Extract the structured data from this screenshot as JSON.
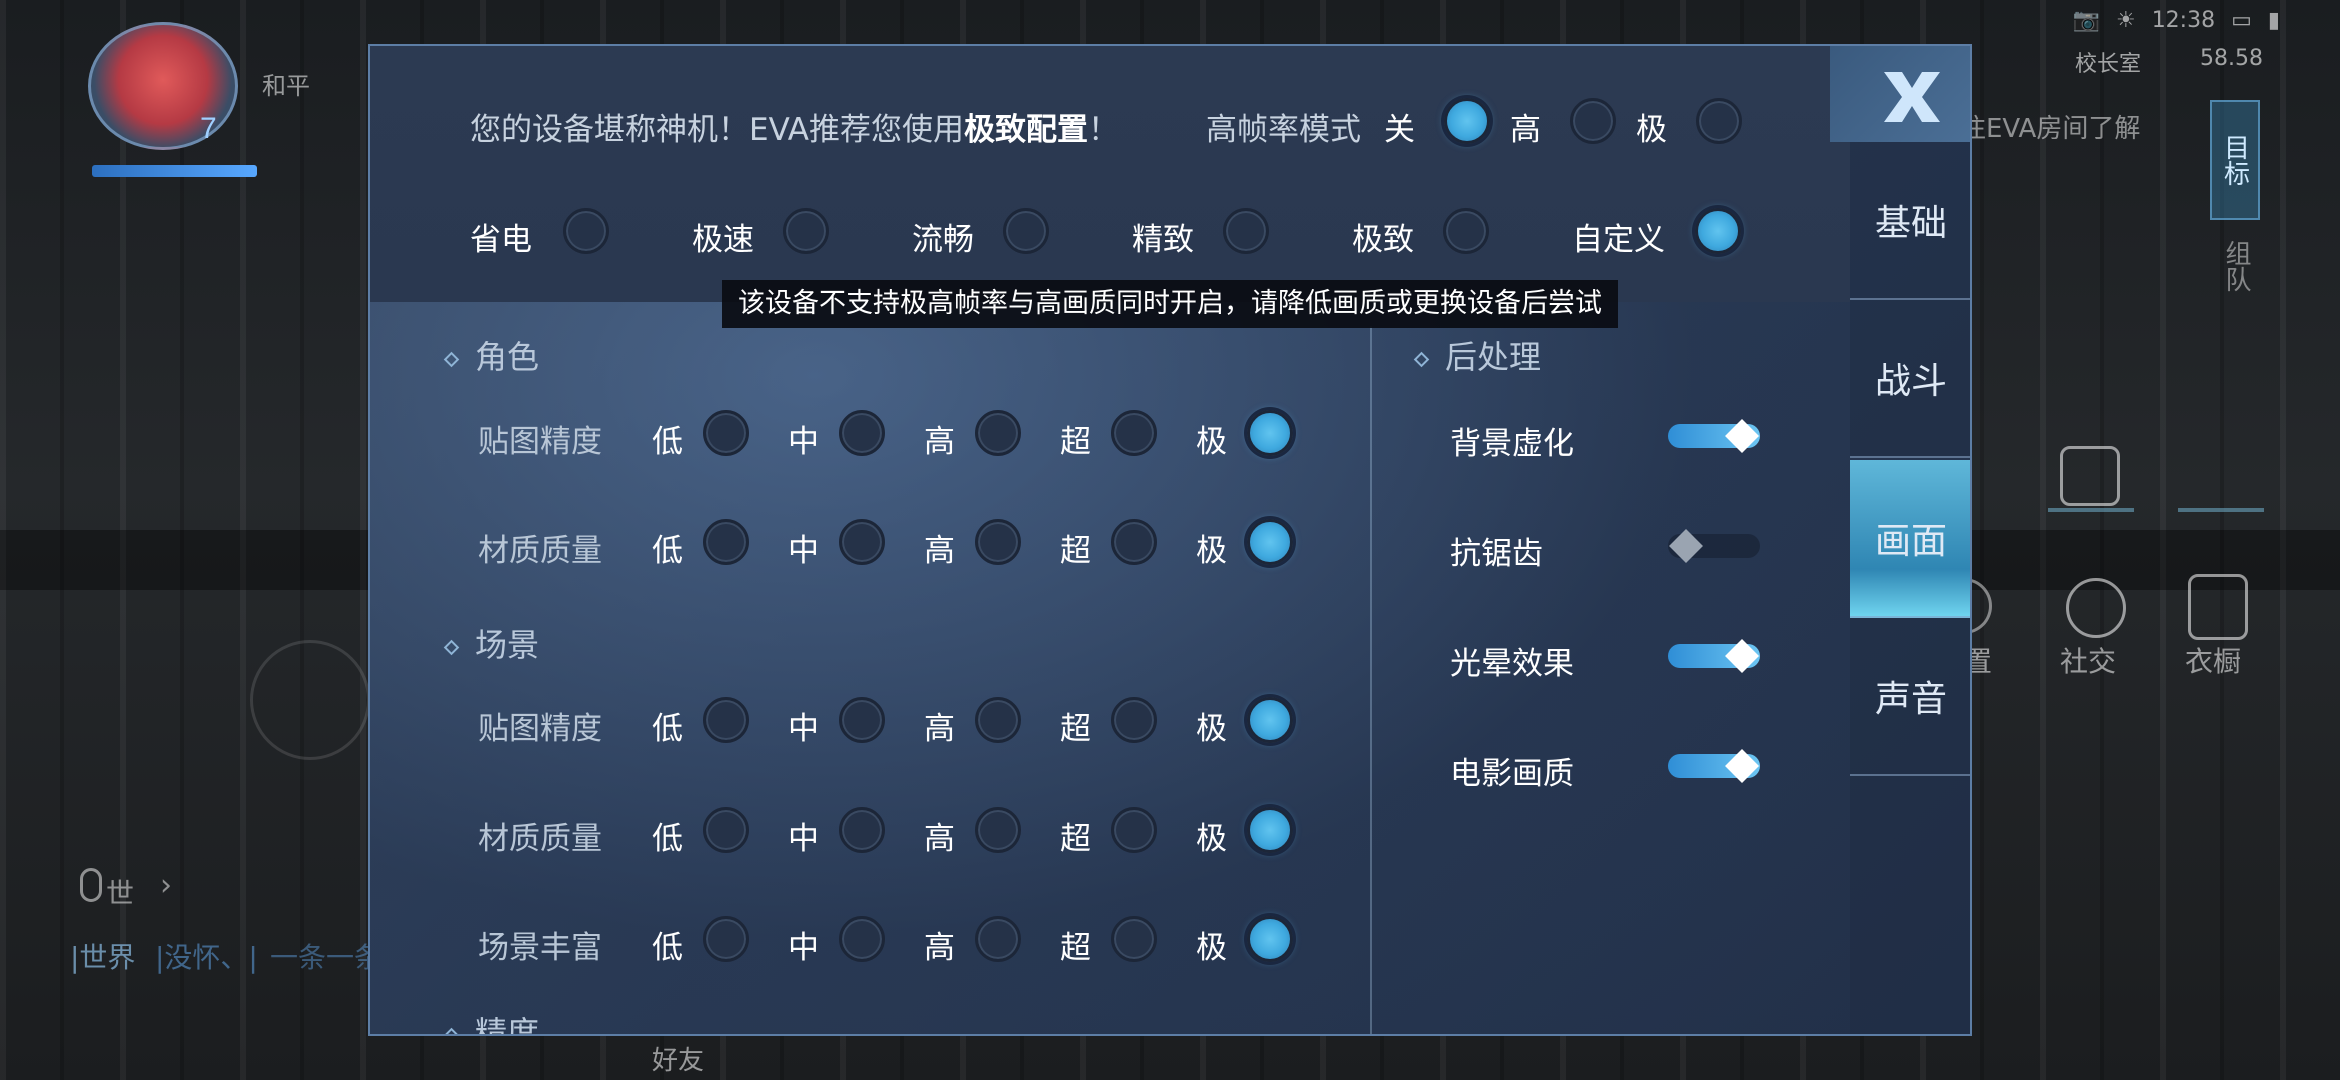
{
  "hud": {
    "player_name": "和平",
    "avatar_level": "7",
    "status_time": "12:38",
    "room_label": "校长室",
    "fps_label": "58.58",
    "eva_hint": "往EVA房间了解",
    "target_label": "目标",
    "team_label": "组队",
    "settings_partial": "置",
    "social_label": "社交",
    "wardrobe_label": "衣橱",
    "chat_channel": "世",
    "chat_world": "|世界",
    "chat_msg": "|没怀、|",
    "chat_msg2": "一条一条",
    "friends_label": "好友"
  },
  "panel": {
    "recommend_prefix": "您的设备堪称神机！EVA推荐您使用",
    "recommend_bold": "极致配置",
    "recommend_suffix": "！",
    "hfr_label": "高帧率模式",
    "hfr_options": [
      {
        "label": "关",
        "on": true
      },
      {
        "label": "高",
        "on": false
      },
      {
        "label": "极",
        "on": false
      }
    ],
    "presets": [
      {
        "label": "省电",
        "on": false
      },
      {
        "label": "极速",
        "on": false
      },
      {
        "label": "流畅",
        "on": false
      },
      {
        "label": "精致",
        "on": false
      },
      {
        "label": "极致",
        "on": false
      },
      {
        "label": "自定义",
        "on": true
      }
    ],
    "notice": "该设备不支持极高帧率与高画质同时开启，请降低画质或更换设备后尝试",
    "sections": {
      "character": "角色",
      "scene": "场景",
      "precision": "精度",
      "postprocess": "后处理"
    },
    "levels": [
      "低",
      "中",
      "高",
      "超",
      "极"
    ],
    "rows": [
      {
        "label": "贴图精度",
        "selected": 4
      },
      {
        "label": "材质质量",
        "selected": 4
      },
      {
        "label": "贴图精度",
        "selected": 4
      },
      {
        "label": "材质质量",
        "selected": 4
      },
      {
        "label": "场景丰富",
        "selected": 4
      }
    ],
    "postprocess": [
      {
        "label": "背景虚化",
        "on": true
      },
      {
        "label": "抗锯齿",
        "on": false
      },
      {
        "label": "光晕效果",
        "on": true
      },
      {
        "label": "电影画质",
        "on": true
      }
    ],
    "tabs": [
      {
        "label": "基础",
        "active": false
      },
      {
        "label": "战斗",
        "active": false
      },
      {
        "label": "画面",
        "active": true
      },
      {
        "label": "声音",
        "active": false
      }
    ]
  }
}
